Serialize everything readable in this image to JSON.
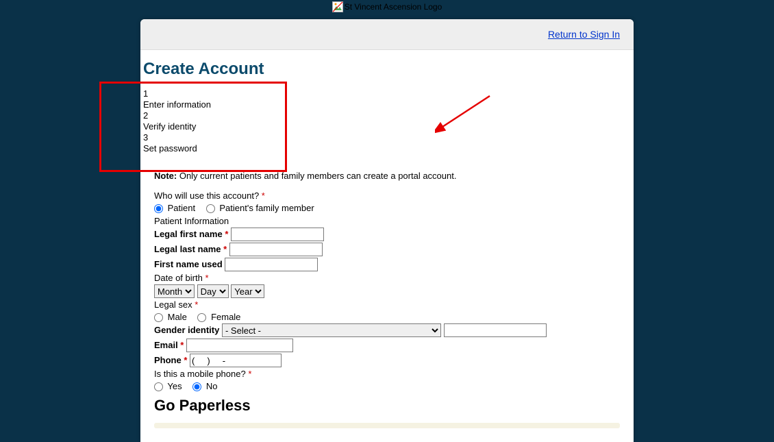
{
  "logo_alt": "St Vincent Ascension Logo",
  "header": {
    "return_link": "Return to Sign In"
  },
  "title": "Create Account",
  "steps": [
    {
      "num": "1",
      "label": "Enter information"
    },
    {
      "num": "2",
      "label": "Verify identity"
    },
    {
      "num": "3",
      "label": "Set password"
    }
  ],
  "note_bold": "Note:",
  "note_text": " Only current patients and family members can create a portal account.",
  "who_q": "Who will use this account? ",
  "who_options": {
    "patient": "Patient",
    "family": "Patient's family member"
  },
  "patient_info_label": "Patient Information",
  "fields": {
    "legal_first": "Legal first name ",
    "legal_last": "Legal last name ",
    "first_used": "First name used",
    "dob": "Date of birth ",
    "month": "Month",
    "day": "Day",
    "year": "Year",
    "legal_sex": "Legal sex ",
    "male": "Male",
    "female": "Female",
    "gender_identity": "Gender identity",
    "gender_select_default": "- Select -",
    "email": "Email ",
    "phone": "Phone ",
    "phone_value": "(     )     -",
    "is_mobile": "Is this a mobile phone? ",
    "yes": "Yes",
    "no": "No"
  },
  "go_paperless": "Go Paperless"
}
